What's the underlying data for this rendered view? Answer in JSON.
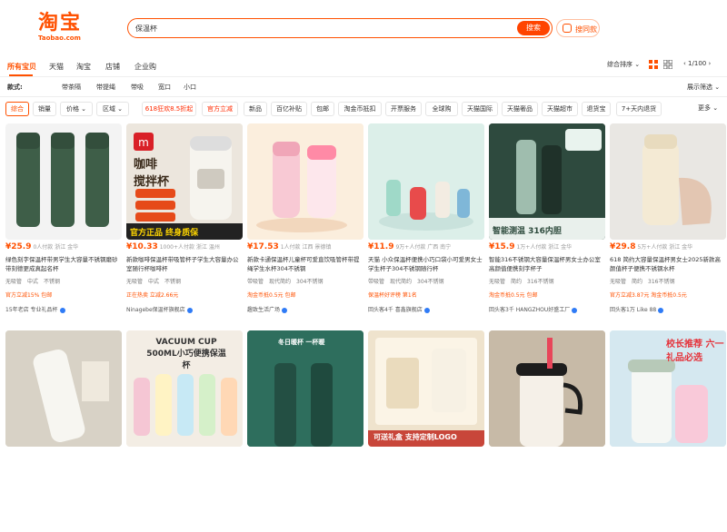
{
  "header": {
    "logo_cn": "淘宝",
    "logo_en": "Taobao.com",
    "search_value": "保温杯",
    "search_button": "搜索",
    "photo_search": "搜同款"
  },
  "tabs": [
    "所有宝贝",
    "天猫",
    "淘宝",
    "店铺",
    "企业购"
  ],
  "toolbar": {
    "sort": "综合排序",
    "page": "1/100"
  },
  "style_row": {
    "label": "款式:",
    "options": [
      "带茶隔",
      "带提绳",
      "带吸",
      "宽口",
      "小口"
    ],
    "more": "展示筛选"
  },
  "chips": [
    "综合",
    "销量",
    "价格",
    "区域",
    "618狂欢8.5折起",
    "官方立减",
    "新品",
    "百亿补贴",
    "包邮",
    "淘金币抵扣",
    "开票服务",
    "全球购",
    "天猫国际",
    "天猫奢品",
    "天猫超市",
    "退货宝",
    "7+天内退货",
    "更多"
  ],
  "products": [
    {
      "price": "¥25.9",
      "sold": "0人付款 浙江 金华",
      "title": "绿色刻字保温杯带男学生大容量不锈钢磨砂带刻德更成真起名杯",
      "attrs": [
        "无吸管",
        "中式",
        "不锈钢"
      ],
      "promo": "官方立减15% 包邮",
      "shop": "15年老店 专业礼品杯"
    },
    {
      "price": "¥10.33",
      "sold": "1000+人付款 浙江 温州",
      "title": "新款咖啡保温杯带吸管杯子学生大容量办公室随行杯咖啡杯",
      "attrs": [
        "无吸管",
        "中式",
        "不锈钢"
      ],
      "promo": "正在热卖 立减2.66元",
      "shop": "Ninagebe保温杯旗舰店",
      "overlay": "官方正品 终身质保"
    },
    {
      "price": "¥17.53",
      "sold": "1人付款 江西 景德镇",
      "title": "新款卡通保温杯儿童杯可爱直饮吸管杯带提绳学生水杯304不锈钢",
      "attrs": [
        "带吸管",
        "现代简约",
        "304不锈钢"
      ],
      "promo": "淘金币抵0.5元 包邮",
      "shop": "趣致生活广场"
    },
    {
      "price": "¥11.9",
      "sold": "9万+人付款 广西 南宁",
      "title": "天猫 小众保温杯便携小巧口袋小可爱男女士学生杯子304不锈钢随行杯",
      "attrs": [
        "带吸管",
        "现代简约",
        "304不锈钢"
      ],
      "promo": "保温杯好评榜 第1名",
      "shop": "回头客4千 喜鑫旗舰店"
    },
    {
      "price": "¥15.9",
      "sold": "1万+人付款 浙江 金华",
      "title": "智能316不锈钢大容量保温杯男女士办公室高颜值便携刻字杯子",
      "attrs": [
        "无吸管",
        "简约",
        "316不锈钢"
      ],
      "promo": "淘金币抵0.5元 包邮",
      "shop": "回头客3千 HANGZHOU好盛工厂",
      "overlay": "智能测温 316内胆"
    },
    {
      "price": "¥29.8",
      "sold": "5万+人付款 浙江 金华",
      "title": "618 简约大容量保温杯男女士2025新款高颜值杯子便携不锈钢水杯",
      "attrs": [
        "无吸管",
        "简约",
        "316不锈钢"
      ],
      "promo": "官方立减3.87元 淘金币抵0.5元",
      "shop": "回头客1万 Like 88"
    },
    {
      "price": "",
      "sold": "",
      "title": "",
      "attrs": [],
      "promo": "",
      "shop": ""
    },
    {
      "price": "",
      "sold": "",
      "title": "",
      "attrs": [],
      "promo": "",
      "shop": "",
      "overlay": "VACUUM CUP 500ML小巧便携保温杯"
    },
    {
      "price": "",
      "sold": "",
      "title": "",
      "attrs": [],
      "promo": "",
      "shop": "",
      "overlay": "冬日暖杯 一杯暖"
    },
    {
      "price": "",
      "sold": "",
      "title": "",
      "attrs": [],
      "promo": "",
      "shop": "",
      "overlay": "可送礼盒 支持定制LOGO"
    },
    {
      "price": "",
      "sold": "",
      "title": "",
      "attrs": [],
      "promo": "",
      "shop": ""
    },
    {
      "price": "",
      "sold": "",
      "title": "",
      "attrs": [],
      "promo": "",
      "shop": "",
      "overlay": "校长推荐 六一礼品必选"
    }
  ],
  "colors": {
    "brand": "#ff5000",
    "bg": "#ffffff"
  }
}
